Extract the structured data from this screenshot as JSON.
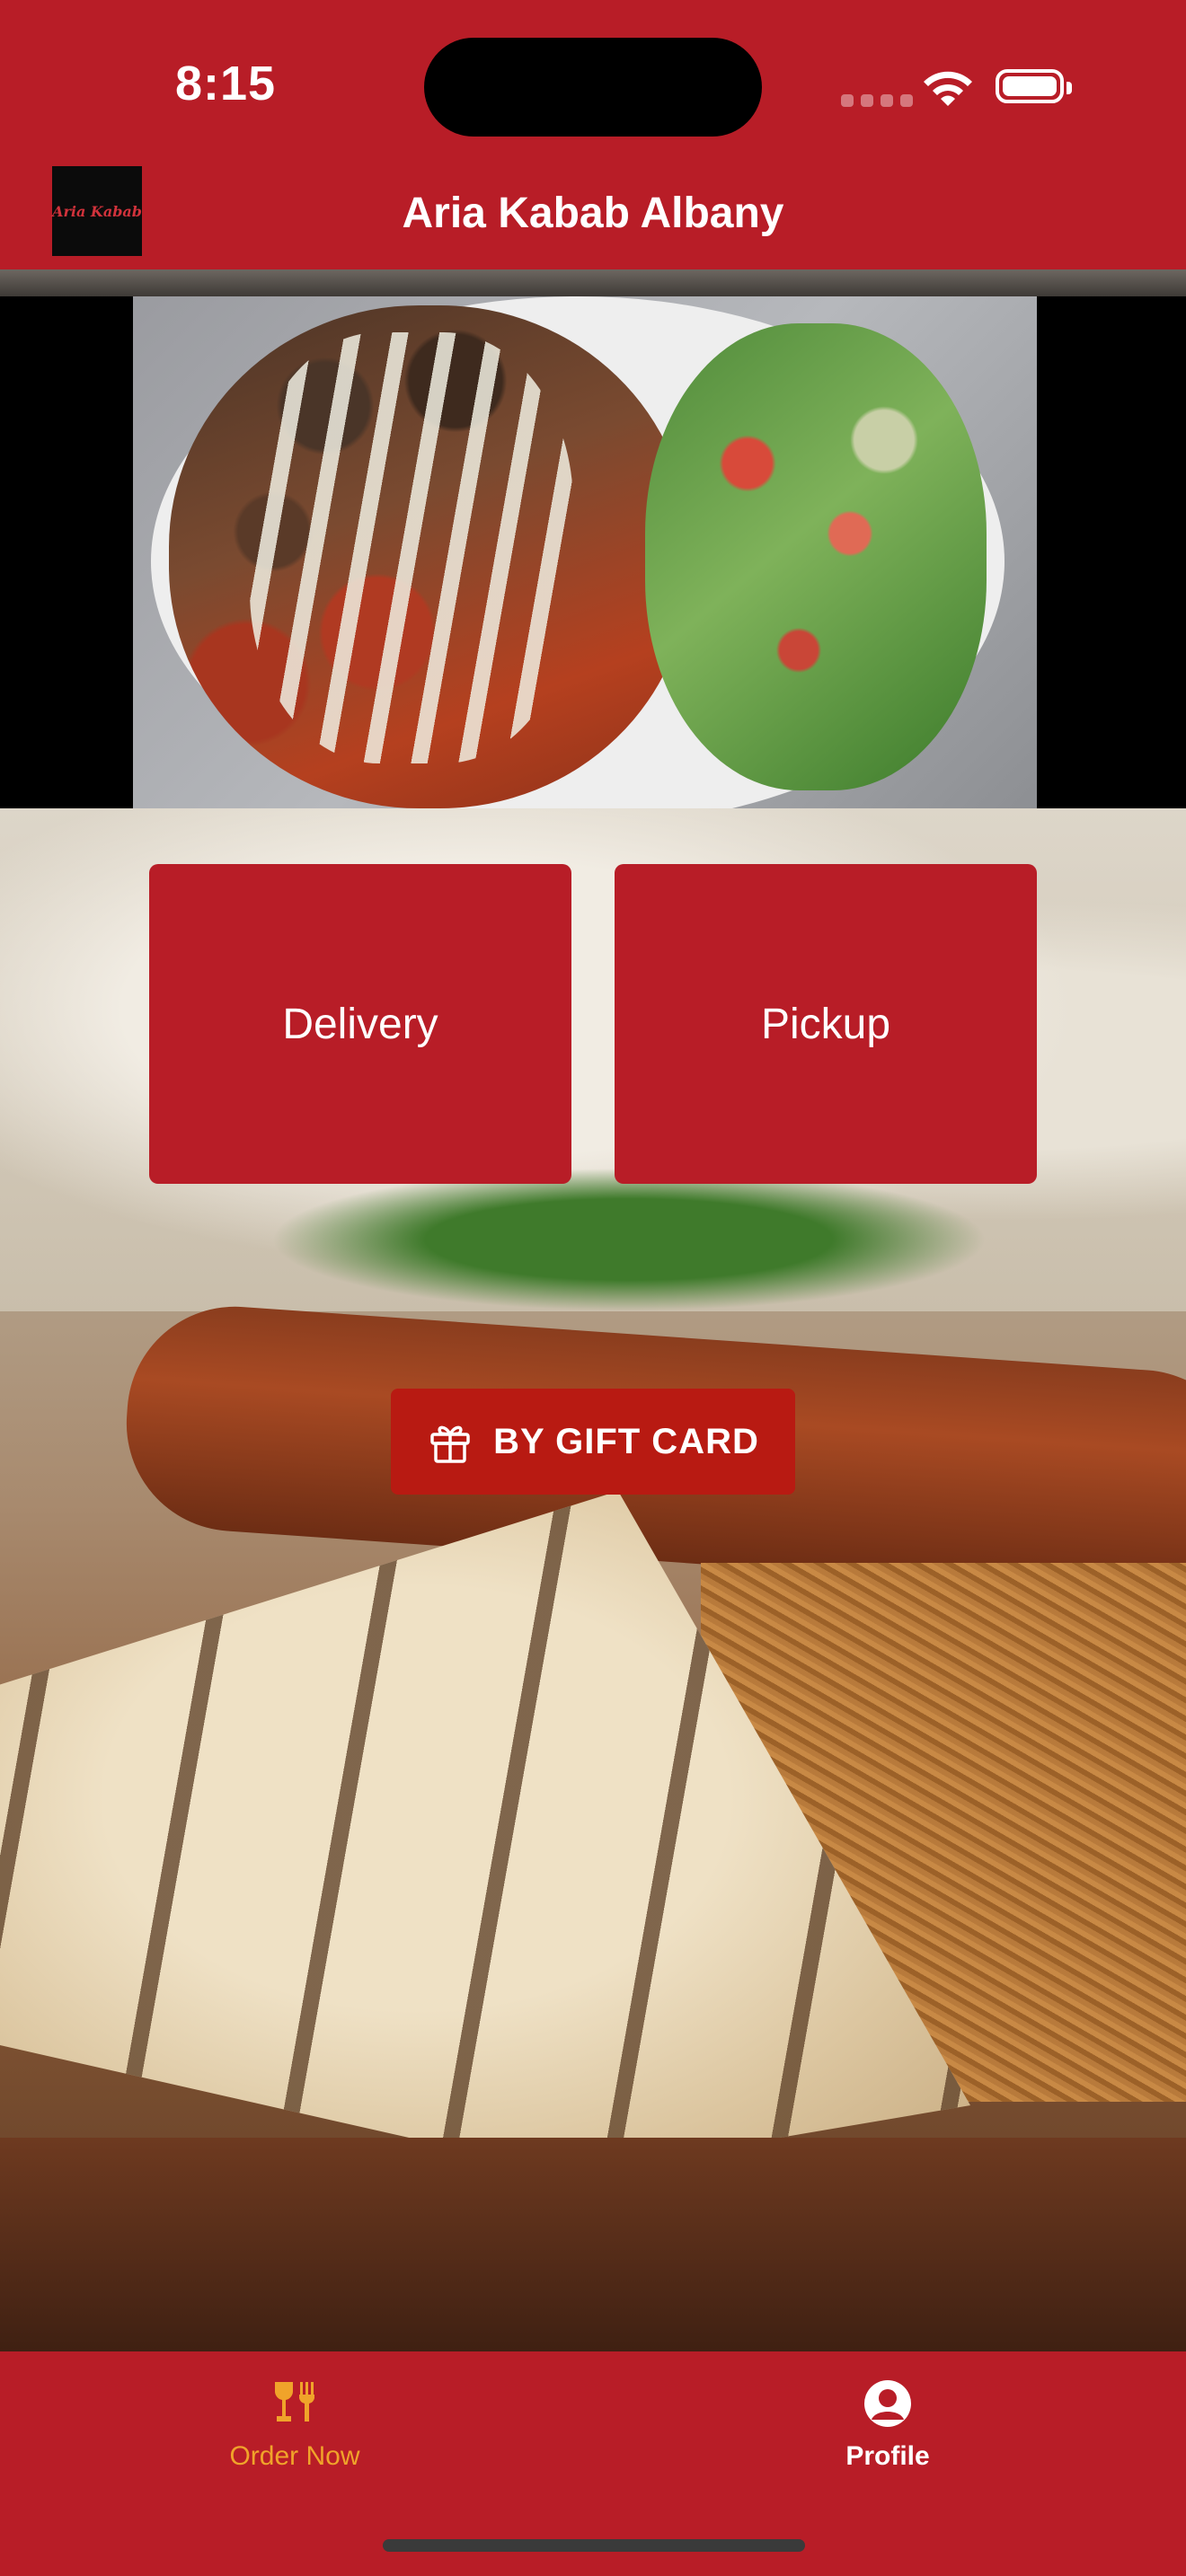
{
  "status_bar": {
    "time": "8:15"
  },
  "header": {
    "logo_text": "Aria Kabab",
    "title": "Aria Kabab Albany"
  },
  "actions": {
    "delivery_label": "Delivery",
    "pickup_label": "Pickup"
  },
  "gift": {
    "label": "BY GIFT CARD",
    "icon": "gift-icon"
  },
  "tabbar": {
    "items": [
      {
        "label": "Order Now",
        "icon": "dining-icon",
        "active": true
      },
      {
        "label": "Profile",
        "icon": "profile-icon",
        "active": false
      }
    ]
  },
  "colors": {
    "brand_red": "#b81d27",
    "gift_button": "#b81a12",
    "active_tab": "#f0a32a",
    "inactive_tab": "#ffffff"
  }
}
